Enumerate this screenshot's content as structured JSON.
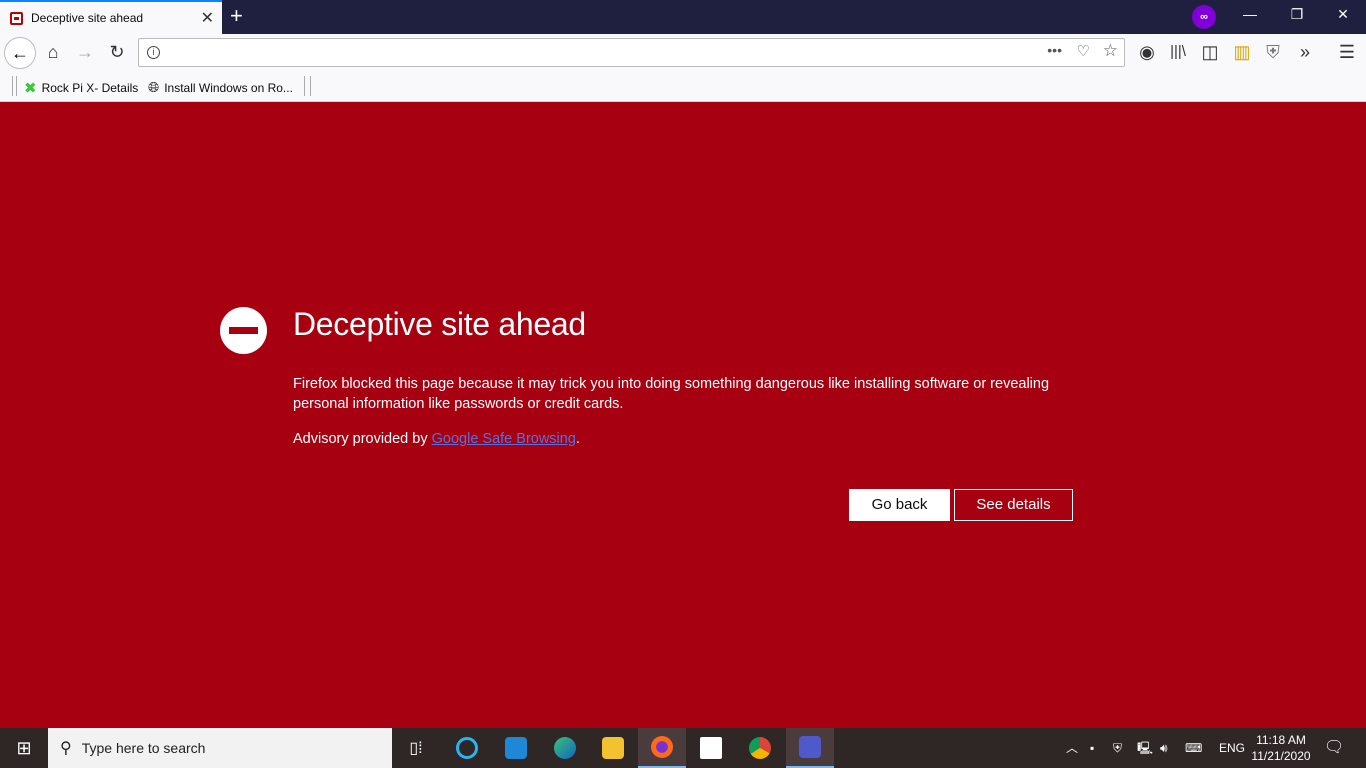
{
  "browser": {
    "tab_title": "Deceptive site ahead",
    "new_tab": "+",
    "window_controls": {
      "minimize": "—",
      "restore": "❐",
      "close": "✕"
    },
    "url": "",
    "toolbar_icons": [
      "back-icon",
      "home-icon",
      "forward-icon",
      "reload-icon",
      "page-actions-icon",
      "pocket-icon",
      "bookmark-star-icon",
      "account-icon",
      "library-icon",
      "sidebar-icon",
      "extension-meter-icon",
      "privacy-badger-icon",
      "overflow-icon",
      "menu-icon"
    ],
    "private_mask": "∞",
    "bookmarks": [
      {
        "label": "Rock Pi X- Details",
        "icon": "rockpi-icon"
      },
      {
        "label": "Install Windows on Ro...",
        "icon": "globe-icon"
      }
    ]
  },
  "page": {
    "title": "Deceptive site ahead",
    "body": "Firefox blocked this page because it may trick you into doing something dangerous like installing software or revealing personal information like passwords or credit cards.",
    "advisory_prefix": "Advisory provided by ",
    "advisory_link": "Google Safe Browsing",
    "advisory_suffix": ".",
    "go_back": "Go back",
    "see_details": "See details",
    "background_color": "#a60011"
  },
  "taskbar": {
    "search_placeholder": "Type here to search",
    "apps": [
      "task-view",
      "cortana",
      "mail",
      "edge",
      "file-explorer",
      "firefox",
      "store",
      "chrome",
      "teams"
    ],
    "active_app": "firefox",
    "language": "ENG",
    "time": "11:18 AM",
    "date": "11/21/2020"
  }
}
